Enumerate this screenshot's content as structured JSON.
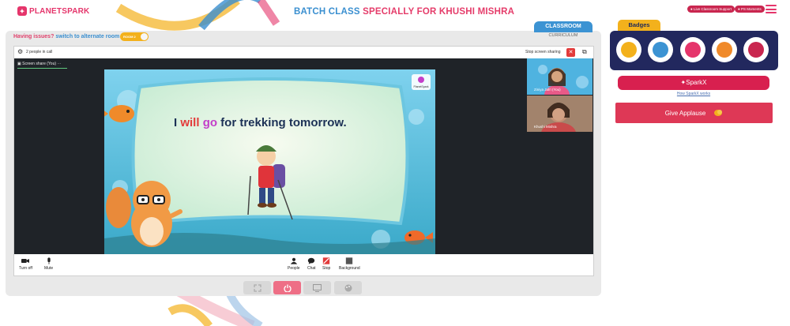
{
  "header": {
    "logo_text": "PLANETSPARK",
    "title_part1": "BATCH CLASS",
    "title_part2": "SPECIALLY FOR KHUSHI MISHRA",
    "support_pill": "Live Classroom Support",
    "moments_pill": "PS Moments"
  },
  "classroom": {
    "issues_label": "Having issues?",
    "switch_label": "switch to alternate room",
    "toggle_label": "ROOM 2",
    "tab_classroom": "CLASSROOM",
    "tab_curriculum": "CURRICULUM"
  },
  "meet": {
    "people_in_call": "2 people in call",
    "stop_sharing": "Stop screen sharing",
    "screen_share_label": "Screen share (You)",
    "slide_sentence_pre": "I ",
    "slide_word_will": "will",
    "slide_word_space": " ",
    "slide_word_go": "go",
    "slide_sentence_post": " for trekking tomorrow.",
    "slide_logo_text": "PlanetSpark",
    "participants": [
      {
        "name": "Ziniya Jafri (You)"
      },
      {
        "name": "Khushi Mishra"
      }
    ],
    "controls": {
      "turn_off": "Turn off",
      "mute": "Mute",
      "people": "People",
      "chat": "Chat",
      "stop": "Stop",
      "background": "Background"
    }
  },
  "sidebar": {
    "badges_label": "Badges",
    "badge_colors": [
      "#f3b11c",
      "#3c93d3",
      "#e5356b",
      "#f08a2a",
      "#c9264f"
    ],
    "sparkx_label": "SparkX",
    "how_sparkx": "How SparkX works",
    "give_applause": "Give Applause"
  },
  "colors": {
    "brand_pink": "#e5356b",
    "brand_blue": "#3a8fd0",
    "badges_bg": "#22285e",
    "accent_yellow": "#f3b11c"
  }
}
